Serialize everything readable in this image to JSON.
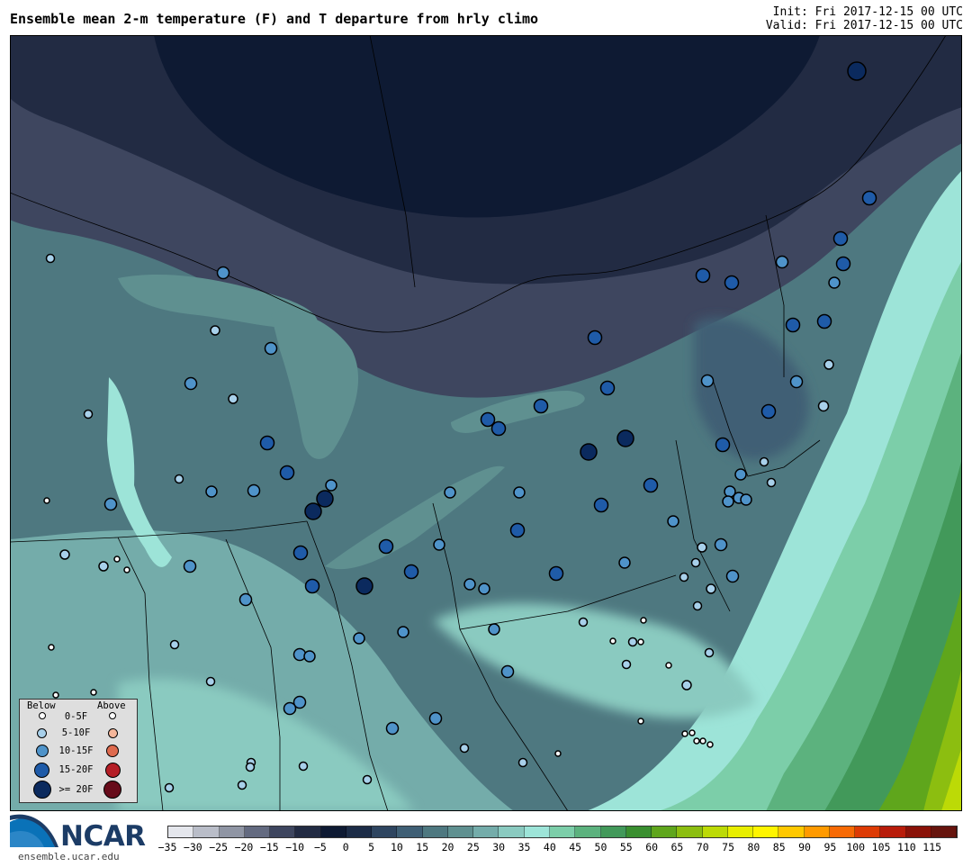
{
  "header": {
    "title": "Ensemble mean 2-m temperature (F) and T departure from hrly climo",
    "init": "Init: Fri 2017-12-15 00 UTC",
    "valid": "Valid: Fri 2017-12-15 00 UTC"
  },
  "legend": {
    "below": "Below",
    "above": "Above",
    "rows": [
      {
        "label": "0-5F",
        "below_color": "#ffffff",
        "above_color": "#ffffff",
        "size": 8
      },
      {
        "label": "5-10F",
        "below_color": "#a8d0ea",
        "above_color": "#f4b69a",
        "size": 11
      },
      {
        "label": "10-15F",
        "below_color": "#4f93c9",
        "above_color": "#de6a4e",
        "size": 14
      },
      {
        "label": "15-20F",
        "below_color": "#1f5ba8",
        "above_color": "#b51e26",
        "size": 17
      },
      {
        "label": ">= 20F",
        "below_color": "#0b2a5e",
        "above_color": "#670b1a",
        "size": 20
      }
    ]
  },
  "branding": {
    "logo": "NCAR",
    "site": "ensemble.ucar.edu"
  },
  "colorbar": {
    "ticks": [
      "−35",
      "−30",
      "−25",
      "−20",
      "−15",
      "−10",
      "−5",
      "0",
      "5",
      "10",
      "15",
      "20",
      "25",
      "30",
      "35",
      "40",
      "45",
      "50",
      "55",
      "60",
      "65",
      "70",
      "75",
      "80",
      "85",
      "90",
      "95",
      "100",
      "105",
      "110",
      "115"
    ],
    "colors": [
      "#e4e6ec",
      "#b9bdc8",
      "#8f95a4",
      "#636a80",
      "#3e465f",
      "#222b43",
      "#0e1a33",
      "#1c2c47",
      "#2e4560",
      "#3f5f75",
      "#4e7880",
      "#5f9090",
      "#74acaa",
      "#8acac0",
      "#9de4d8",
      "#7ccea9",
      "#5cb27e",
      "#42995a",
      "#3a8f30",
      "#5fa61c",
      "#8cbe10",
      "#bcda06",
      "#e8ee00",
      "#fff500",
      "#ffc800",
      "#ff9a00",
      "#f76a05",
      "#dd3b05",
      "#b81c0a",
      "#8a1208",
      "#66140d"
    ],
    "sea_green": "#9de4d8"
  },
  "map": {
    "stations": [
      {
        "cat": 4,
        "dir": "below"
      },
      {
        "cat": 3,
        "dir": "below"
      },
      {
        "cat": 2,
        "dir": "below"
      },
      {
        "cat": 1,
        "dir": "below"
      },
      {
        "cat": 0,
        "dir": "above"
      }
    ]
  }
}
